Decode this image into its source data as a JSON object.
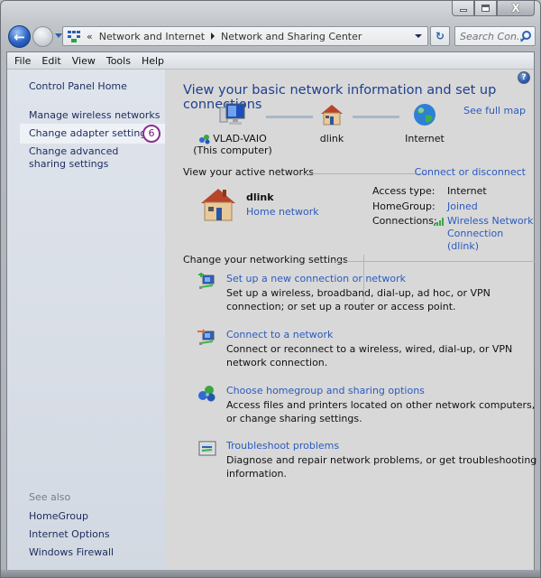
{
  "window": {
    "caption_buttons": [
      "minimize",
      "maximize",
      "close"
    ],
    "close_glyph": "X"
  },
  "nav": {
    "back_glyph": "←",
    "forward_glyph": "→",
    "address_overflow": "«",
    "breadcrumbs": [
      "Network and Internet",
      "Network and Sharing Center"
    ],
    "refresh_glyph": "↻",
    "search_placeholder": "Search Con..."
  },
  "menubar": {
    "items": [
      "File",
      "Edit",
      "View",
      "Tools",
      "Help"
    ]
  },
  "sidebar": {
    "home": "Control Panel Home",
    "links": [
      "Manage wireless networks",
      "Change adapter settings",
      "Change advanced sharing settings"
    ],
    "selected": "Change adapter settings",
    "step_badge": "6",
    "see_also_label": "See also",
    "see_also": [
      "HomeGroup",
      "Internet Options",
      "Windows Firewall"
    ]
  },
  "main": {
    "help_glyph": "?",
    "title": "View your basic network information and set up connections",
    "see_full_map": "See full map",
    "network_map": {
      "computer_name": "VLAD-VAIO",
      "computer_sub": "(This computer)",
      "router": "dlink",
      "internet": "Internet"
    },
    "active_networks": {
      "heading": "View your active networks",
      "action": "Connect or disconnect",
      "network_name": "dlink",
      "network_type": "Home network",
      "access_type_label": "Access type:",
      "access_type_value": "Internet",
      "homegroup_label": "HomeGroup:",
      "homegroup_value": "Joined",
      "connections_label": "Connections:",
      "connection_line1": "Wireless Network",
      "connection_line2": "Connection (dlink)"
    },
    "settings": {
      "heading": "Change your networking settings",
      "tasks": [
        {
          "icon": "new-connection-icon",
          "title": "Set up a new connection or network",
          "desc": "Set up a wireless, broadband, dial-up, ad hoc, or VPN connection; or set up a router or access point."
        },
        {
          "icon": "connect-network-icon",
          "title": "Connect to a network",
          "desc": "Connect or reconnect to a wireless, wired, dial-up, or VPN network connection."
        },
        {
          "icon": "homegroup-icon",
          "title": "Choose homegroup and sharing options",
          "desc": "Access files and printers located on other network computers, or change sharing settings."
        },
        {
          "icon": "troubleshoot-icon",
          "title": "Troubleshoot problems",
          "desc": "Diagnose and repair network problems, or get troubleshooting information."
        }
      ]
    }
  },
  "colors": {
    "link": "#2a5bbf",
    "title": "#1e3f8f",
    "sidebar_link": "#1c2b5e",
    "step_badge": "#8a2f8f"
  }
}
